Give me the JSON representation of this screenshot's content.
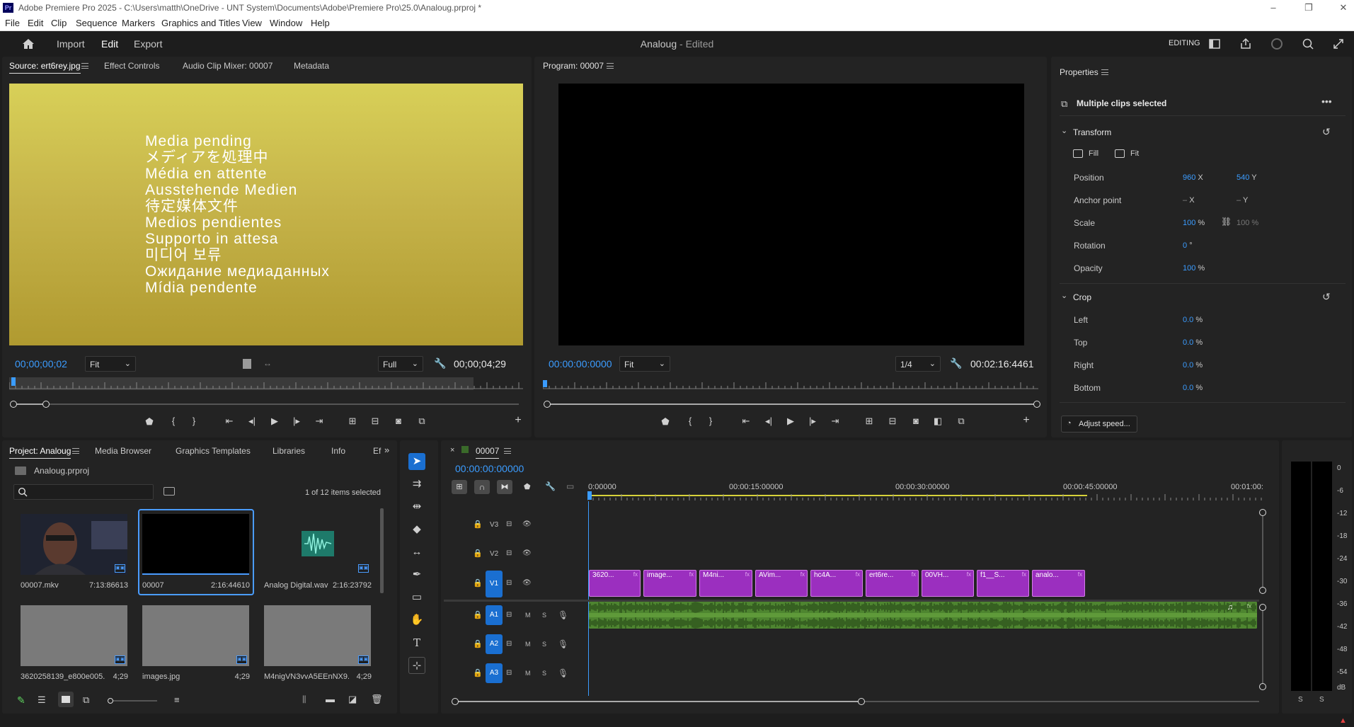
{
  "window": {
    "title": "Adobe Premiere Pro 2025 - C:\\Users\\matth\\OneDrive - UNT System\\Documents\\Adobe\\Premiere Pro\\25.0\\Analoug.prproj *",
    "app_icon": "Pr"
  },
  "menu": [
    "File",
    "Edit",
    "Clip",
    "Sequence",
    "Markers",
    "Graphics and Titles",
    "View",
    "Window",
    "Help"
  ],
  "header": {
    "tabs": [
      "Import",
      "Edit",
      "Export"
    ],
    "active_tab": "Edit",
    "project_name": "Analoug",
    "project_status": " - Edited",
    "workspace": "EDITING"
  },
  "source": {
    "tabs": [
      "Source: ert6rey.jpg",
      "Effect Controls",
      "Audio Clip Mixer: 00007",
      "Metadata"
    ],
    "pending_lines": [
      "Media pending",
      "メディアを処理中",
      "Média en attente",
      "Ausstehende Medien",
      "待定媒体文件",
      "Medios pendientes",
      "Supporto in attesa",
      "미디어 보류",
      "Ожидание медиаданных",
      "Mídia pendente"
    ],
    "timecode": "00;00;00;02",
    "zoom": "Fit",
    "resolution": "Full",
    "duration": "00;00;04;29"
  },
  "program": {
    "tab": "Program: 00007",
    "timecode": "00:00:00:0000",
    "zoom": "Fit",
    "resolution": "1/4",
    "duration": "00:02:16:4461"
  },
  "properties": {
    "tab": "Properties",
    "selection": "Multiple clips selected",
    "transform": {
      "heading": "Transform",
      "fill": "Fill",
      "fit": "Fit",
      "position_label": "Position",
      "position_x": "960",
      "position_y": "540",
      "anchor_label": "Anchor point",
      "anchor_x": "–",
      "anchor_y": "–",
      "scale_label": "Scale",
      "scale": "100",
      "scale_linked": "100",
      "rotation_label": "Rotation",
      "rotation": "0",
      "opacity_label": "Opacity",
      "opacity": "100"
    },
    "crop": {
      "heading": "Crop",
      "left_label": "Left",
      "left": "0.0",
      "top_label": "Top",
      "top": "0.0",
      "right_label": "Right",
      "right": "0.0",
      "bottom_label": "Bottom",
      "bottom": "0.0"
    },
    "adjust_speed": "Adjust speed..."
  },
  "project": {
    "tabs": [
      "Project: Analoug",
      "Media Browser",
      "Graphics Templates",
      "Libraries",
      "Info",
      "Ef"
    ],
    "file": "Analoug.prproj",
    "search_placeholder": "",
    "selection_count": "1 of 12 items selected",
    "items": [
      {
        "name": "00007.mkv",
        "duration": "7:13:86613"
      },
      {
        "name": "00007",
        "duration": "2:16:44610"
      },
      {
        "name": "Analog Digital.wav",
        "duration": "2:16:23792"
      },
      {
        "name": "3620258139_e800e005...",
        "duration": "4;29"
      },
      {
        "name": "images.jpg",
        "duration": "4;29"
      },
      {
        "name": "M4nigVN3vvA5EEnNX9...",
        "duration": "4;29"
      }
    ]
  },
  "timeline": {
    "sequence": "00007",
    "timecode": "00:00:00:00000",
    "ruler": [
      "0:00000",
      "00:00:15:00000",
      "00:00:30:00000",
      "00:00:45:00000",
      "00:01:00:"
    ],
    "video_tracks": [
      "V3",
      "V2",
      "V1"
    ],
    "audio_tracks": [
      "A1",
      "A2",
      "A3"
    ],
    "clips": [
      "3620...",
      "image...",
      "M4ni...",
      "AVim...",
      "hc4A...",
      "ert6re...",
      "00VH...",
      "f1__S...",
      "analo..."
    ],
    "audio_meter_scale": [
      "0",
      "-6",
      "-12",
      "-18",
      "-24",
      "-30",
      "-36",
      "-42",
      "-48",
      "-54",
      "dB"
    ],
    "meter_solo": [
      "S",
      "S"
    ]
  },
  "colors": {
    "accent": "#3b9cff",
    "video_clip": "#9b2fbf",
    "audio_clip": "#5f9a3a",
    "panel": "#232323",
    "background": "#1d1d1d"
  }
}
